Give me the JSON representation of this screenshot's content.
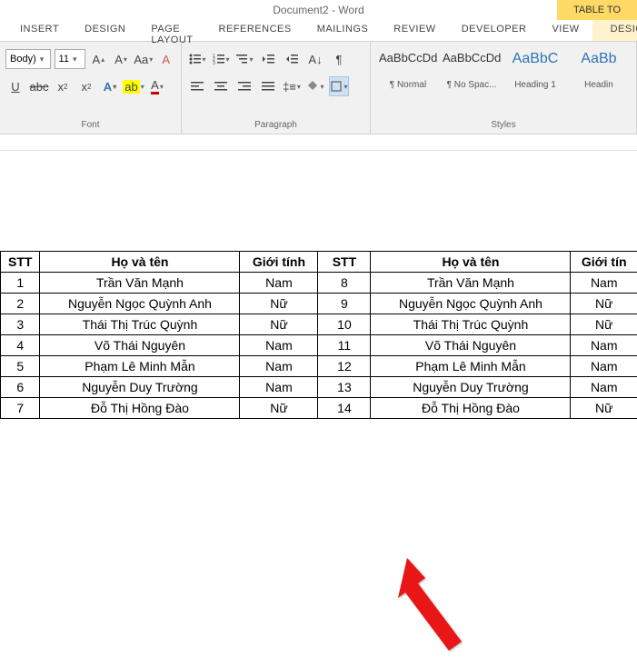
{
  "title": "Document2 - Word",
  "contextTab": "TABLE TO",
  "tabs": [
    "INSERT",
    "DESIGN",
    "PAGE LAYOUT",
    "REFERENCES",
    "MAILINGS",
    "REVIEW",
    "DEVELOPER",
    "VIEW"
  ],
  "contextTabLabel": "DESIGN",
  "font": {
    "family": "Body)",
    "size": "11"
  },
  "groupLabels": {
    "font": "Font",
    "paragraph": "Paragraph",
    "styles": "Styles"
  },
  "styles": [
    {
      "preview": "AaBbCcDd",
      "name": "¶ Normal",
      "cls": ""
    },
    {
      "preview": "AaBbCcDd",
      "name": "¶ No Spac...",
      "cls": ""
    },
    {
      "preview": "AaBbC",
      "name": "Heading 1",
      "cls": "h1"
    },
    {
      "preview": "AaBb",
      "name": "Headin",
      "cls": "h1"
    }
  ],
  "tableHeaders": {
    "stt": "STT",
    "name": "Họ và tên",
    "gender": "Giới tính",
    "genderCut": "Giới tín"
  },
  "rows": [
    {
      "a": "1",
      "b": "Trần Văn Mạnh",
      "c": "Nam",
      "d": "8",
      "e": "Trần Văn Mạnh",
      "f": "Nam"
    },
    {
      "a": "2",
      "b": "Nguyễn Ngọc Quỳnh Anh",
      "c": "Nữ",
      "d": "9",
      "e": "Nguyễn Ngọc Quỳnh Anh",
      "f": "Nữ"
    },
    {
      "a": "3",
      "b": "Thái Thị Trúc Quỳnh",
      "c": "Nữ",
      "d": "10",
      "e": "Thái Thị Trúc Quỳnh",
      "f": "Nữ"
    },
    {
      "a": "4",
      "b": "Võ  Thái Nguyên",
      "c": "Nam",
      "d": "11",
      "e": "Võ  Thái Nguyên",
      "f": "Nam"
    },
    {
      "a": "5",
      "b": "Phạm Lê Minh Mẫn",
      "c": "Nam",
      "d": "12",
      "e": "Phạm Lê Minh Mẫn",
      "f": "Nam"
    },
    {
      "a": "6",
      "b": "Nguyễn Duy Trường",
      "c": "Nam",
      "d": "13",
      "e": "Nguyễn Duy Trường",
      "f": "Nam"
    },
    {
      "a": "7",
      "b": "Đỗ Thị Hồng Đào",
      "c": "Nữ",
      "d": "14",
      "e": "Đỗ Thị Hồng Đào",
      "f": "Nữ"
    }
  ]
}
